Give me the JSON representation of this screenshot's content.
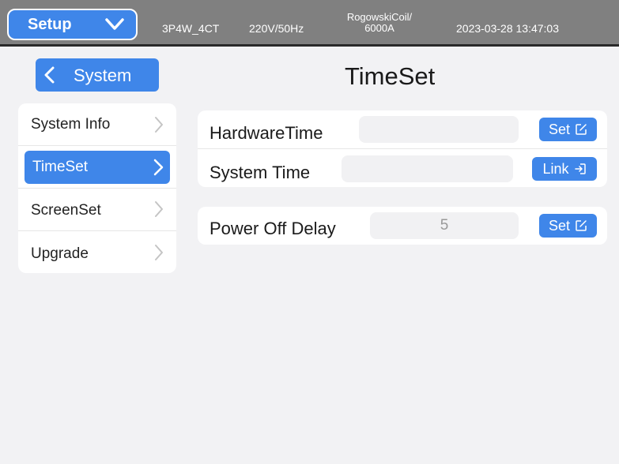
{
  "header": {
    "setup_label": "Setup",
    "wiring": "3P4W_4CT",
    "voltage": "220V/50Hz",
    "coil_line1": "RogowskiCoil/",
    "coil_line2": "6000A",
    "datetime": "2023-03-28 13:47:03"
  },
  "nav": {
    "back_label": "System"
  },
  "page": {
    "title": "TimeSet"
  },
  "sidebar": {
    "items": [
      {
        "label": "System Info",
        "active": false
      },
      {
        "label": "TimeSet",
        "active": true
      },
      {
        "label": "ScreenSet",
        "active": false
      },
      {
        "label": "Upgrade",
        "active": false
      }
    ]
  },
  "time_card": {
    "hardware_label": "HardwareTime",
    "hardware_value": "",
    "hardware_button": "Set",
    "system_label": "System Time",
    "system_value": "",
    "system_button": "Link"
  },
  "power_card": {
    "label": "Power Off Delay",
    "value": "5",
    "button": "Set"
  },
  "colors": {
    "accent": "#3f86e9",
    "topbar": "#808080",
    "background": "#f2f2f4"
  },
  "icons": {
    "setup_dropdown": "chevron-down-icon",
    "back": "chevron-left-icon",
    "edit": "edit-icon",
    "link": "link-arrow-icon",
    "item": "chevron-right-icon"
  }
}
